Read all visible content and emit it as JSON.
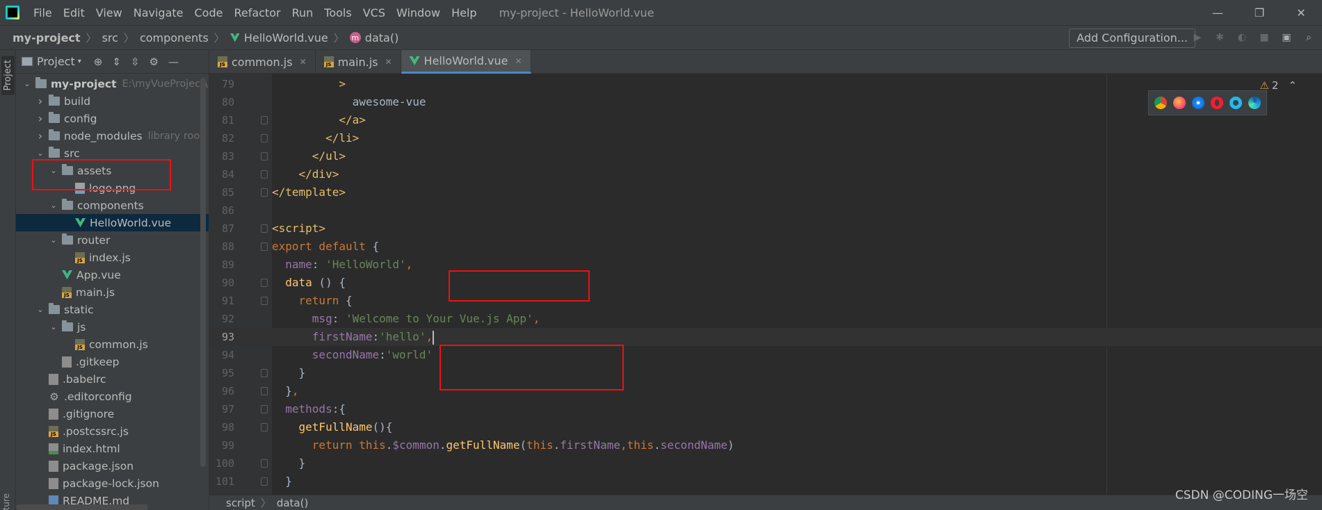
{
  "menubar": {
    "items": [
      "File",
      "Edit",
      "View",
      "Navigate",
      "Code",
      "Refactor",
      "Run",
      "Tools",
      "VCS",
      "Window",
      "Help"
    ],
    "title": "my-project - HelloWorld.vue"
  },
  "navbar": {
    "crumbs": [
      "my-project",
      "src",
      "components",
      "HelloWorld.vue",
      "data()"
    ],
    "add_config": "Add Configuration..."
  },
  "tool_strip": {
    "project_label": "Project",
    "structure_label": "ture"
  },
  "project_panel": {
    "title": "Project",
    "tree": [
      {
        "label": "my-project",
        "extra": "E:\\myVueProject\\",
        "type": "folder",
        "depth": 0,
        "expanded": true,
        "bold": true
      },
      {
        "label": "build",
        "type": "folder",
        "depth": 1,
        "expanded": false
      },
      {
        "label": "config",
        "type": "folder",
        "depth": 1,
        "expanded": false
      },
      {
        "label": "node_modules",
        "extra": "library root",
        "type": "folder",
        "depth": 1,
        "expanded": false
      },
      {
        "label": "src",
        "type": "folder",
        "depth": 1,
        "expanded": true
      },
      {
        "label": "assets",
        "type": "folder",
        "depth": 2,
        "expanded": true
      },
      {
        "label": "logo.png",
        "type": "img",
        "depth": 3
      },
      {
        "label": "components",
        "type": "folder",
        "depth": 2,
        "expanded": true
      },
      {
        "label": "HelloWorld.vue",
        "type": "vue",
        "depth": 3,
        "selected": true
      },
      {
        "label": "router",
        "type": "folder",
        "depth": 2,
        "expanded": true
      },
      {
        "label": "index.js",
        "type": "js",
        "depth": 3
      },
      {
        "label": "App.vue",
        "type": "vue",
        "depth": 2
      },
      {
        "label": "main.js",
        "type": "js",
        "depth": 2
      },
      {
        "label": "static",
        "type": "folder",
        "depth": 1,
        "expanded": true
      },
      {
        "label": "js",
        "type": "folder",
        "depth": 2,
        "expanded": true
      },
      {
        "label": "common.js",
        "type": "js",
        "depth": 3
      },
      {
        "label": ".gitkeep",
        "type": "gen",
        "depth": 2
      },
      {
        "label": ".babelrc",
        "type": "gen",
        "depth": 1
      },
      {
        "label": ".editorconfig",
        "type": "gear",
        "depth": 1
      },
      {
        "label": ".gitignore",
        "type": "gen",
        "depth": 1
      },
      {
        "label": ".postcssrc.js",
        "type": "js",
        "depth": 1
      },
      {
        "label": "index.html",
        "type": "html",
        "depth": 1
      },
      {
        "label": "package.json",
        "type": "gen",
        "depth": 1
      },
      {
        "label": "package-lock.json",
        "type": "gen",
        "depth": 1
      },
      {
        "label": "README.md",
        "type": "md",
        "depth": 1
      }
    ]
  },
  "tabs": [
    {
      "label": "common.js",
      "type": "js",
      "active": false
    },
    {
      "label": "main.js",
      "type": "js",
      "active": false
    },
    {
      "label": "HelloWorld.vue",
      "type": "vue",
      "active": true
    }
  ],
  "editor": {
    "warnings": "2",
    "current_line": 93,
    "lines": [
      {
        "n": "79",
        "html": "          <span class='tag'>&gt;</span>"
      },
      {
        "n": "80",
        "html": "            <span class='txt'>awesome-vue</span>"
      },
      {
        "n": "81",
        "html": "          <span class='tag'>&lt;/a&gt;</span>"
      },
      {
        "n": "82",
        "html": "        <span class='tag'>&lt;/li&gt;</span>"
      },
      {
        "n": "83",
        "html": "      <span class='tag'>&lt;/ul&gt;</span>"
      },
      {
        "n": "84",
        "html": "    <span class='tag'>&lt;/div&gt;</span>"
      },
      {
        "n": "85",
        "html": "<span class='tag'>&lt;/template&gt;</span>"
      },
      {
        "n": "86",
        "html": ""
      },
      {
        "n": "87",
        "html": "<span class='tag'>&lt;script&gt;</span>"
      },
      {
        "n": "88",
        "html": "<span class='kw'>export default</span> {"
      },
      {
        "n": "89",
        "html": "  <span class='prop'>name</span>: <span class='str'>'HelloWorld'</span><span class='kw'>,</span>"
      },
      {
        "n": "90",
        "html": "  <span class='fn'>data</span> () {"
      },
      {
        "n": "91",
        "html": "    <span class='kw'>return</span> {"
      },
      {
        "n": "92",
        "html": "      <span class='prop'>msg</span>: <span class='str'>'Welcome to Your Vue.js App'</span><span class='kw'>,</span>"
      },
      {
        "n": "93",
        "html": "      <span class='prop'>firstName</span>:<span class='str'>'hello'</span><span class='kw'>,</span><span class='caret'></span>"
      },
      {
        "n": "94",
        "html": "      <span class='prop'>secondName</span>:<span class='str'>'world'</span>"
      },
      {
        "n": "95",
        "html": "    }"
      },
      {
        "n": "96",
        "html": "  }<span class='kw'>,</span>"
      },
      {
        "n": "97",
        "html": "  <span class='prop'>methods</span>:{"
      },
      {
        "n": "98",
        "html": "    <span class='fn'>getFullName</span>(){"
      },
      {
        "n": "99",
        "html": "      <span class='kw'>return this</span>.<span class='prop'>$common</span>.<span class='fn'>getFullName</span>(<span class='kw'>this</span>.<span class='prop'>firstName</span><span class='kw'>,this</span>.<span class='prop'>secondName</span>)"
      },
      {
        "n": "100",
        "html": "    }"
      },
      {
        "n": "101",
        "html": "  }"
      }
    ]
  },
  "statusbar": {
    "crumbs": [
      "script",
      "data()"
    ]
  },
  "watermark": "CSDN @CODING一场空",
  "colors": {
    "highlight_box": "#e11111",
    "accent": "#4a88c7"
  }
}
